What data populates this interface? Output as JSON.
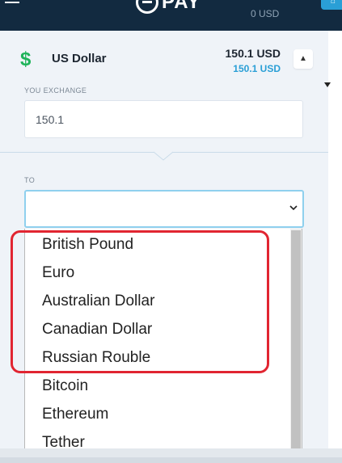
{
  "header": {
    "logo_text": "PAY",
    "top_amount": "0 USD"
  },
  "currency": {
    "icon": "dollar-icon",
    "name": "US Dollar",
    "amount_main": "150.1 USD",
    "amount_sub": "150.1 USD"
  },
  "exchange": {
    "label": "YOU EXCHANGE",
    "value": "150.1"
  },
  "to": {
    "label": "TO",
    "selected": ""
  },
  "dropdown": {
    "options": [
      "British Pound",
      "Euro",
      "Australian Dollar",
      "Canadian Dollar",
      "Russian Rouble",
      "Bitcoin",
      "Ethereum",
      "Tether"
    ]
  },
  "colors": {
    "header_bg": "#122a40",
    "panel_bg": "#eff3f8",
    "accent_blue": "#2a9fd6",
    "dollar_green": "#1fb35a",
    "highlight_red": "#e12531"
  }
}
